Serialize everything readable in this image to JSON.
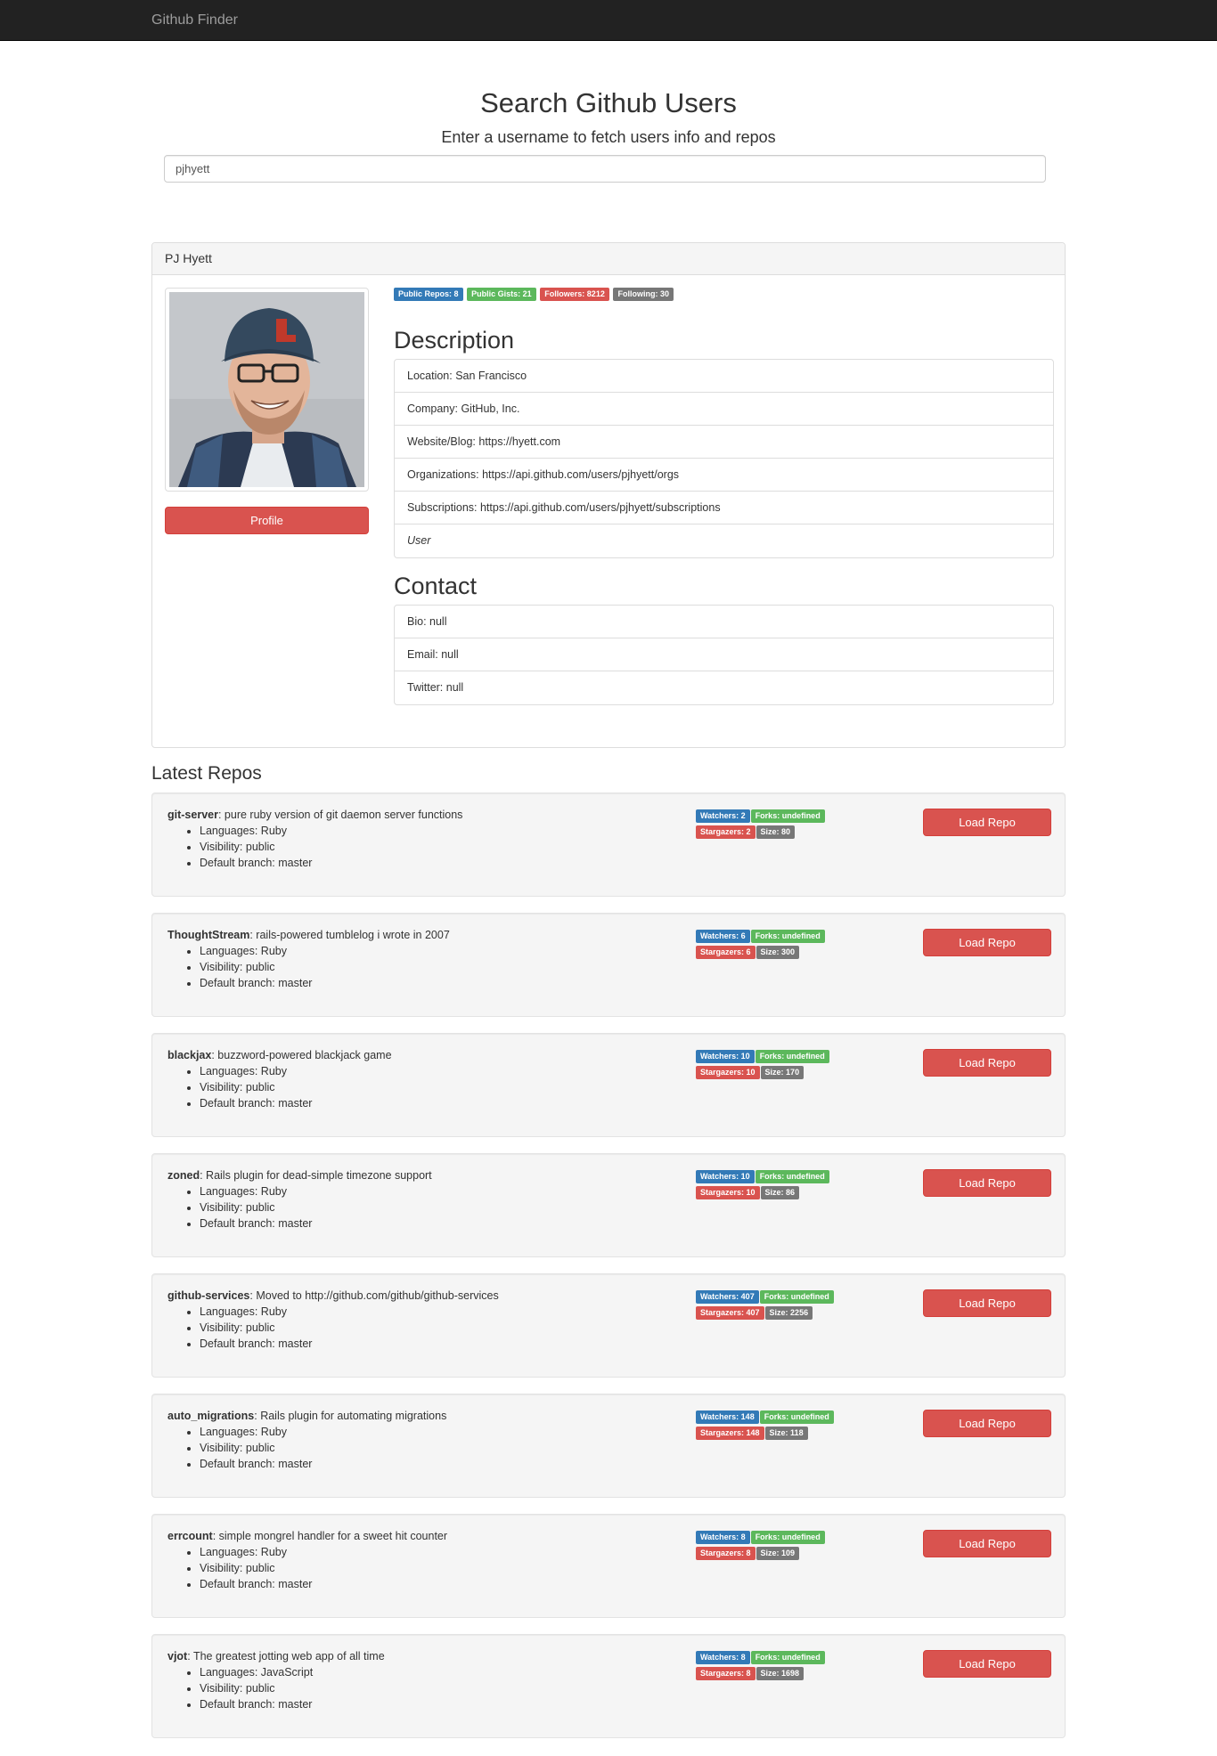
{
  "nav": {
    "brand": "Github Finder"
  },
  "search": {
    "title": "Search Github Users",
    "subtitle": "Enter a username to fetch users info and repos",
    "value": "pjhyett"
  },
  "user": {
    "name": "PJ Hyett",
    "profile_label": "Profile",
    "badges": {
      "public_repos": "Public Repos: 8",
      "public_gists": "Public Gists: 21",
      "followers": "Followers: 8212",
      "following": "Following: 30"
    },
    "description_title": "Description",
    "description": [
      "Location: San Francisco",
      "Company: GitHub, Inc.",
      "Website/Blog: https://hyett.com",
      "Organizations: https://api.github.com/users/pjhyett/orgs",
      "Subscriptions: https://api.github.com/users/pjhyett/subscriptions",
      "User"
    ],
    "contact_title": "Contact",
    "contact": [
      "Bio: null",
      "Email: null",
      "Twitter: null"
    ]
  },
  "repos_title": "Latest Repos",
  "repos": [
    {
      "name": "git-server",
      "desc": ": pure ruby version of git daemon server functions",
      "lang": "Languages: Ruby",
      "vis": "Visibility: public",
      "branch": "Default branch: master",
      "watchers": "Watchers: 2",
      "forks": "Forks: undefined",
      "stars": "Stargazers: 2",
      "size": "Size: 80",
      "button": "Load Repo"
    },
    {
      "name": "ThoughtStream",
      "desc": ": rails-powered tumblelog i wrote in 2007",
      "lang": "Languages: Ruby",
      "vis": "Visibility: public",
      "branch": "Default branch: master",
      "watchers": "Watchers: 6",
      "forks": "Forks: undefined",
      "stars": "Stargazers: 6",
      "size": "Size: 300",
      "button": "Load Repo"
    },
    {
      "name": "blackjax",
      "desc": ": buzzword-powered blackjack game",
      "lang": "Languages: Ruby",
      "vis": "Visibility: public",
      "branch": "Default branch: master",
      "watchers": "Watchers: 10",
      "forks": "Forks: undefined",
      "stars": "Stargazers: 10",
      "size": "Size: 170",
      "button": "Load Repo"
    },
    {
      "name": "zoned",
      "desc": ": Rails plugin for dead-simple timezone support",
      "lang": "Languages: Ruby",
      "vis": "Visibility: public",
      "branch": "Default branch: master",
      "watchers": "Watchers: 10",
      "forks": "Forks: undefined",
      "stars": "Stargazers: 10",
      "size": "Size: 86",
      "button": "Load Repo"
    },
    {
      "name": "github-services",
      "desc": ": Moved to http://github.com/github/github-services",
      "lang": "Languages: Ruby",
      "vis": "Visibility: public",
      "branch": "Default branch: master",
      "watchers": "Watchers: 407",
      "forks": "Forks: undefined",
      "stars": "Stargazers: 407",
      "size": "Size: 2256",
      "button": "Load Repo"
    },
    {
      "name": "auto_migrations",
      "desc": ": Rails plugin for automating migrations",
      "lang": "Languages: Ruby",
      "vis": "Visibility: public",
      "branch": "Default branch: master",
      "watchers": "Watchers: 148",
      "forks": "Forks: undefined",
      "stars": "Stargazers: 148",
      "size": "Size: 118",
      "button": "Load Repo"
    },
    {
      "name": "errcount",
      "desc": ": simple mongrel handler for a sweet hit counter",
      "lang": "Languages: Ruby",
      "vis": "Visibility: public",
      "branch": "Default branch: master",
      "watchers": "Watchers: 8",
      "forks": "Forks: undefined",
      "stars": "Stargazers: 8",
      "size": "Size: 109",
      "button": "Load Repo"
    },
    {
      "name": "vjot",
      "desc": ": The greatest jotting web app of all time",
      "lang": "Languages: JavaScript",
      "vis": "Visibility: public",
      "branch": "Default branch: master",
      "watchers": "Watchers: 8",
      "forks": "Forks: undefined",
      "stars": "Stargazers: 8",
      "size": "Size: 1698",
      "button": "Load Repo"
    }
  ]
}
